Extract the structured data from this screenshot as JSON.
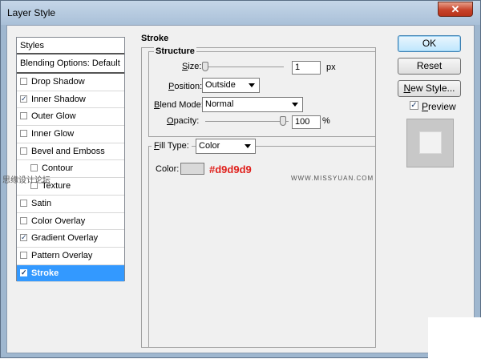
{
  "window": {
    "title": "Layer Style",
    "close_glyph": "✕"
  },
  "styles": {
    "header": "Styles",
    "blending": "Blending Options: Default",
    "items": [
      {
        "label": "Drop Shadow",
        "checked": false
      },
      {
        "label": "Inner Shadow",
        "checked": true
      },
      {
        "label": "Outer Glow",
        "checked": false
      },
      {
        "label": "Inner Glow",
        "checked": false
      },
      {
        "label": "Bevel and Emboss",
        "checked": false
      },
      {
        "label": "Contour",
        "checked": false
      },
      {
        "label": "Texture",
        "checked": false
      },
      {
        "label": "Satin",
        "checked": false
      },
      {
        "label": "Color Overlay",
        "checked": false
      },
      {
        "label": "Gradient Overlay",
        "checked": true
      },
      {
        "label": "Pattern Overlay",
        "checked": false
      },
      {
        "label": "Stroke",
        "checked": true,
        "selected": true
      }
    ],
    "check_glyph": "✓"
  },
  "stroke": {
    "title": "Stroke",
    "structure": {
      "title": "Structure",
      "size_label_u": "S",
      "size_label_rest": "ize:",
      "size_value": "1",
      "size_unit": "px",
      "position_label_u": "P",
      "position_label_rest": "osition:",
      "position_value": "Outside",
      "blend_label_u": "B",
      "blend_label_rest": "lend Mode:",
      "blend_value": "Normal",
      "opacity_label_u": "O",
      "opacity_label_rest": "pacity:",
      "opacity_value": "100",
      "opacity_unit": "%"
    },
    "fill": {
      "type_label_u": "F",
      "type_label_rest": "ill Type:",
      "type_value": "Color",
      "color_label": "Color:",
      "color_hex_text": "#d9d9d9",
      "swatch_color": "#d9d9d9"
    }
  },
  "buttons": {
    "ok": "OK",
    "reset": "Reset",
    "new_style_u": "N",
    "new_style_rest": "ew Style...",
    "preview_u": "P",
    "preview_rest": "review",
    "preview_checked": true
  },
  "watermark": {
    "left": "思缘设计论坛",
    "right": "WWW.MISSYUAN.COM"
  }
}
